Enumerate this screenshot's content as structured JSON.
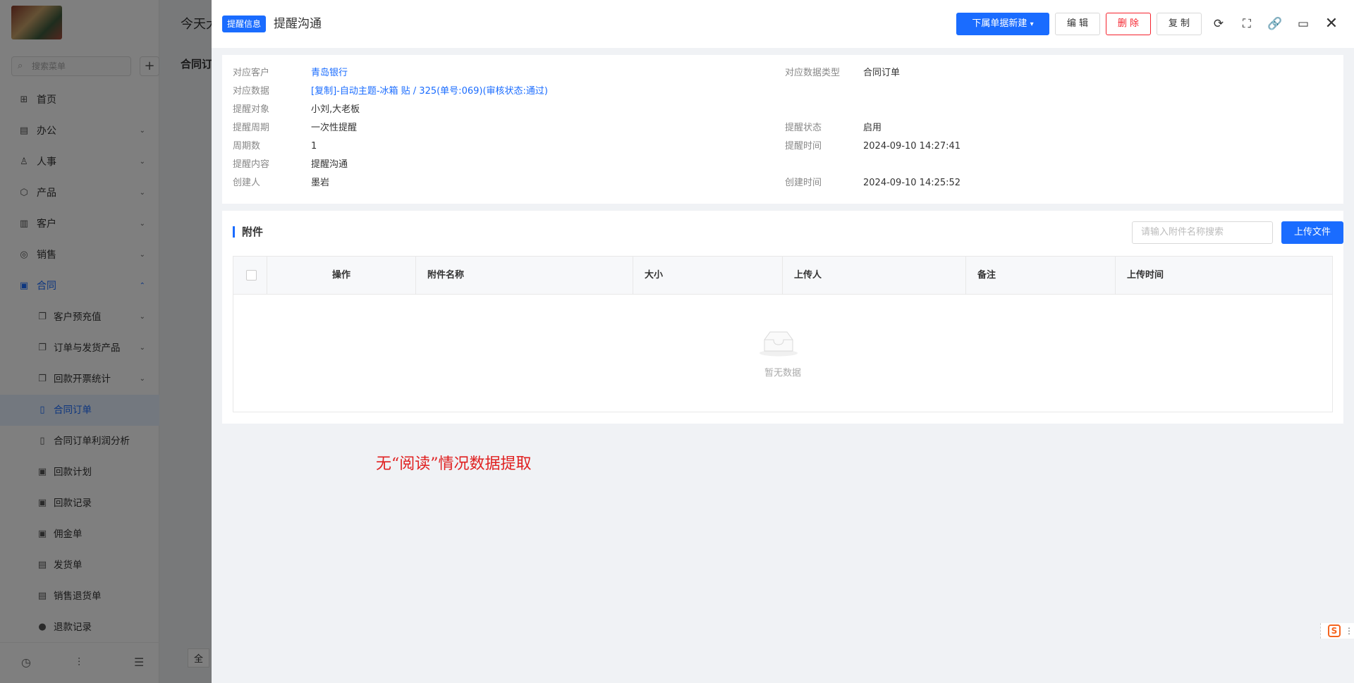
{
  "background": {
    "search_placeholder": "搜索菜单",
    "plus_label": "+",
    "title": "今天大",
    "subtitle": "合同订",
    "footer_text": "全",
    "menu": [
      {
        "label": "首页",
        "icon": "home-icon"
      },
      {
        "label": "办公",
        "icon": "office-icon",
        "arrow": "⌄"
      },
      {
        "label": "人事",
        "icon": "people-icon",
        "arrow": "⌄"
      },
      {
        "label": "产品",
        "icon": "product-icon",
        "arrow": "⌄"
      },
      {
        "label": "客户",
        "icon": "customer-icon",
        "arrow": "⌄"
      },
      {
        "label": "销售",
        "icon": "sales-icon",
        "arrow": "⌄"
      },
      {
        "label": "合同",
        "icon": "contract-icon",
        "arrow": "⌃"
      },
      {
        "label": "客户预充值",
        "icon": "copy-icon",
        "arrow": "⌄"
      },
      {
        "label": "订单与发货产品",
        "icon": "copy-icon",
        "arrow": "⌄"
      },
      {
        "label": "回款开票统计",
        "icon": "copy-icon",
        "arrow": "⌄"
      },
      {
        "label": "合同订单",
        "icon": "doc-icon"
      },
      {
        "label": "合同订单利润分析",
        "icon": "doc-icon"
      },
      {
        "label": "回款计划",
        "icon": "plan-icon"
      },
      {
        "label": "回款记录",
        "icon": "record-icon"
      },
      {
        "label": "佣金单",
        "icon": "commission-icon"
      },
      {
        "label": "发货单",
        "icon": "delivery-icon"
      },
      {
        "label": "销售退货单",
        "icon": "return-icon"
      },
      {
        "label": "退款记录",
        "icon": "refund-icon"
      }
    ]
  },
  "drawer": {
    "tag": "提醒信息",
    "title": "提醒沟通",
    "buttons": {
      "subordinate_new": "下属单据新建",
      "edit": "编 辑",
      "delete": "删 除",
      "copy": "复 制"
    },
    "header_icons": [
      "refresh-icon",
      "fullscreen-icon",
      "link-icon",
      "laptop-icon",
      "close-icon"
    ],
    "info": {
      "customer": {
        "label": "对应客户",
        "value": "青岛银行"
      },
      "data_type": {
        "label": "对应数据类型",
        "value": "合同订单"
      },
      "data": {
        "label": "对应数据",
        "value": "[复制]-自动主题-冰箱 贴 / 325(单号:069)(审核状态:通过)"
      },
      "target": {
        "label": "提醒对象",
        "value": "小刘,大老板"
      },
      "cycle": {
        "label": "提醒周期",
        "value": "一次性提醒"
      },
      "status": {
        "label": "提醒状态",
        "value": "启用"
      },
      "cycle_count": {
        "label": "周期数",
        "value": "1"
      },
      "remind_time": {
        "label": "提醒时间",
        "value": "2024-09-10 14:27:41"
      },
      "content": {
        "label": "提醒内容",
        "value": "提醒沟通"
      },
      "creator": {
        "label": "创建人",
        "value": "墨岩"
      },
      "created_time": {
        "label": "创建时间",
        "value": "2024-09-10 14:25:52"
      }
    },
    "attachments": {
      "title": "附件",
      "search_placeholder": "请输入附件名称搜索",
      "upload_label": "上传文件",
      "columns": [
        "操作",
        "附件名称",
        "大小",
        "上传人",
        "备注",
        "上传时间"
      ],
      "rows": [],
      "empty_text": "暂无数据"
    }
  },
  "annotation": "无“阅读”情况数据提取",
  "corner_widget": {
    "icon_text": "S",
    "dots": "⋮"
  }
}
